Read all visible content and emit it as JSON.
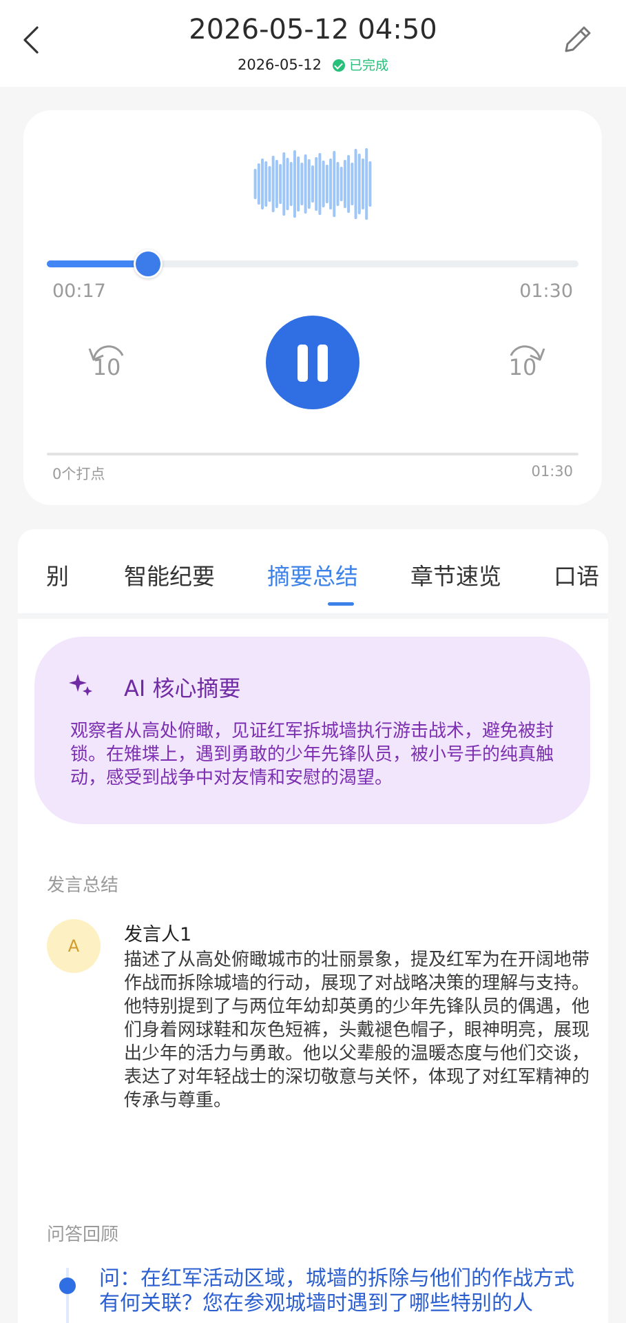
{
  "header": {
    "title": "2026-05-12 04:50",
    "date": "2026-05-12",
    "status": "已完成"
  },
  "player": {
    "current_time": "00:17",
    "total_time": "01:30",
    "progress_fraction": 0.19,
    "rewind_label": "10",
    "forward_label": "10",
    "marks_label": "0个打点",
    "marks_total": "01:30",
    "accent_color": "#2f6ee3"
  },
  "tabs": {
    "items": [
      "识别",
      "智能纪要",
      "摘要总结",
      "章节速览",
      "口语"
    ],
    "active_index": 2
  },
  "ai_summary": {
    "title": "AI 核心摘要",
    "text": "观察者从高处俯瞰，见证红军拆城墙执行游击战术，避免被封锁。在雉堞上，遇到勇敢的少年先锋队员，被小号手的纯真触动，感受到战争中对友情和安慰的渴望。"
  },
  "speech_summary": {
    "section_title": "发言总结",
    "avatar_letter": "A",
    "speaker": "发言人1",
    "text": "描述了从高处俯瞰城市的壮丽景象，提及红军为在开阔地带作战而拆除城墙的行动，展现了对战略决策的理解与支持。他特别提到了与两位年幼却英勇的少年先锋队员的偶遇，他们身着网球鞋和灰色短裤，头戴褪色帽子，眼神明亮，展现出少年的活力与勇敢。他以父辈般的温暖态度与他们交谈，表达了对年轻战士的深切敬意与关怀，体现了对红军精神的传承与尊重。"
  },
  "qa": {
    "section_title": "问答回顾",
    "question": "问：在红军活动区域，城墙的拆除与他们的作战方式有何关联？您在参观城墙时遇到了哪些特别的人"
  }
}
